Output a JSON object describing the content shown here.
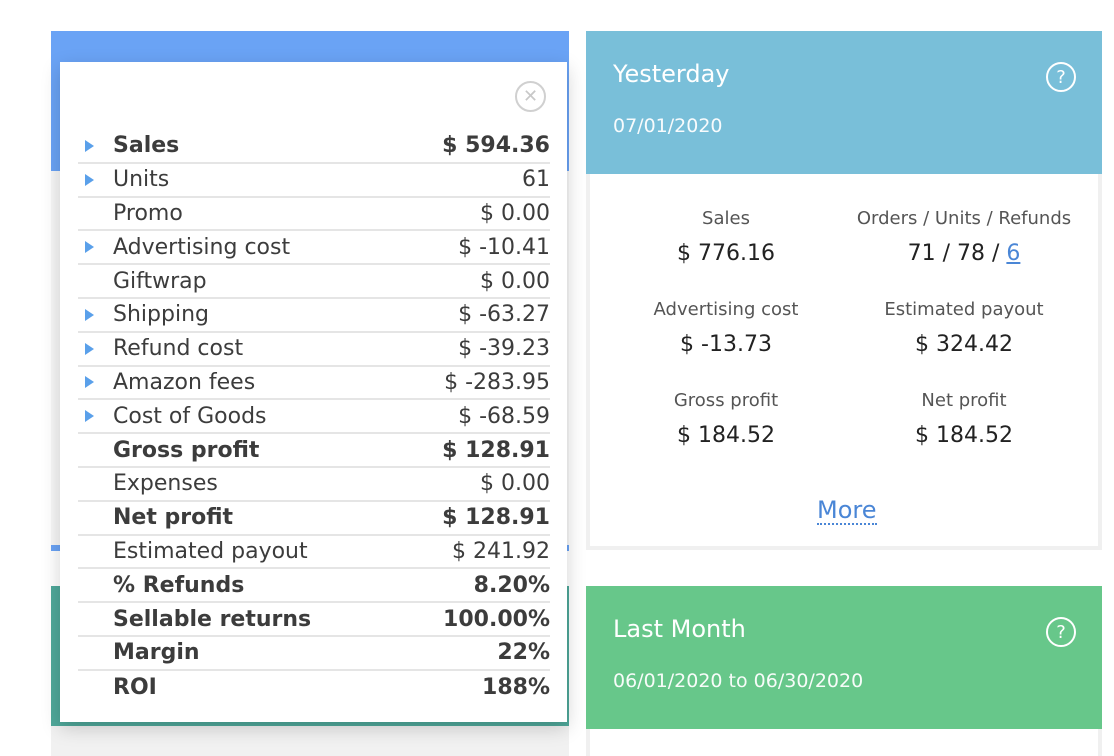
{
  "popup": {
    "close_icon": "close-icon",
    "rows": [
      {
        "label": "Sales",
        "value": "$ 594.36",
        "bold": true,
        "expandable": true
      },
      {
        "label": "Units",
        "value": "61",
        "bold": false,
        "expandable": true
      },
      {
        "label": "Promo",
        "value": "$ 0.00",
        "bold": false,
        "expandable": false
      },
      {
        "label": "Advertising cost",
        "value": "$ -10.41",
        "bold": false,
        "expandable": true
      },
      {
        "label": "Giftwrap",
        "value": "$ 0.00",
        "bold": false,
        "expandable": false
      },
      {
        "label": "Shipping",
        "value": "$ -63.27",
        "bold": false,
        "expandable": true
      },
      {
        "label": "Refund cost",
        "value": "$ -39.23",
        "bold": false,
        "expandable": true
      },
      {
        "label": "Amazon fees",
        "value": "$ -283.95",
        "bold": false,
        "expandable": true
      },
      {
        "label": "Cost of Goods",
        "value": "$ -68.59",
        "bold": false,
        "expandable": true
      },
      {
        "label": "Gross profit",
        "value": "$ 128.91",
        "bold": true,
        "expandable": false
      },
      {
        "label": "Expenses",
        "value": "$ 0.00",
        "bold": false,
        "expandable": false
      },
      {
        "label": "Net profit",
        "value": "$ 128.91",
        "bold": true,
        "expandable": false
      },
      {
        "label": "Estimated payout",
        "value": "$ 241.92",
        "bold": false,
        "expandable": false
      },
      {
        "label": "% Refunds",
        "value": "8.20%",
        "bold": true,
        "expandable": false
      },
      {
        "label": "Sellable returns",
        "value": "100.00%",
        "bold": true,
        "expandable": false
      },
      {
        "label": "Margin",
        "value": "22%",
        "bold": true,
        "expandable": false
      },
      {
        "label": "ROI",
        "value": "188%",
        "bold": true,
        "expandable": false
      }
    ]
  },
  "yesterday": {
    "title": "Yesterday",
    "date": "07/01/2020",
    "help": "?",
    "stats": {
      "sales_label": "Sales",
      "sales_value": "$ 776.16",
      "orders_label": "Orders / Units / Refunds",
      "orders_value_prefix": "71 / 78 / ",
      "refunds_link": "6",
      "ad_label": "Advertising cost",
      "ad_value": "$ -13.73",
      "payout_label": "Estimated payout",
      "payout_value": "$ 324.42",
      "gross_label": "Gross profit",
      "gross_value": "$ 184.52",
      "net_label": "Net profit",
      "net_value": "$ 184.52"
    },
    "more_label": "More"
  },
  "last_month": {
    "title": "Last Month",
    "date_range": "06/01/2020 to 06/30/2020",
    "help": "?"
  },
  "colors": {
    "today_header": "#6aa3f5",
    "yesterday_header": "#79bfd9",
    "last_month_header": "#67c78a",
    "left_green_header": "#4fa89a",
    "link": "#4a86d6",
    "expand_arrow": "#5aa0ea"
  }
}
